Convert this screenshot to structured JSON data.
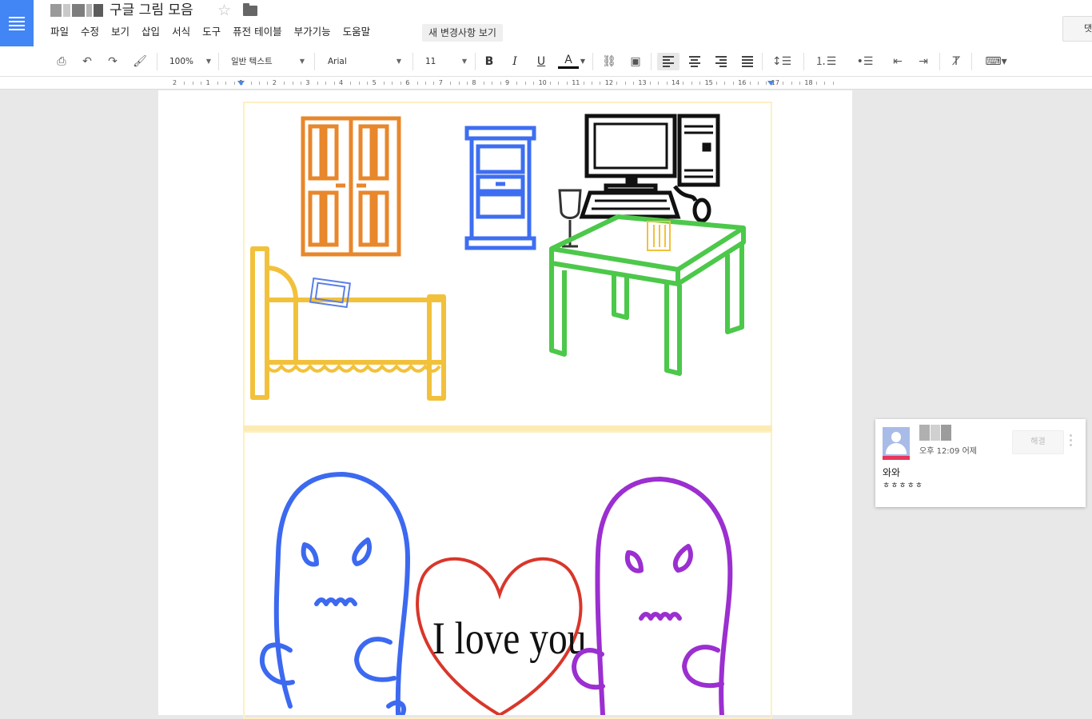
{
  "header": {
    "title": "구글 그림 모음",
    "menu": [
      "파일",
      "수정",
      "보기",
      "삽입",
      "서식",
      "도구",
      "퓨전 테이블",
      "부가기능",
      "도움말"
    ],
    "changes_label": "새 변경사항 보기",
    "comments_label": "댓"
  },
  "toolbar": {
    "zoom": "100%",
    "style": "일반 텍스트",
    "font": "Arial",
    "size": "11",
    "bold": "B",
    "italic": "I",
    "underline": "U",
    "text_color": "A"
  },
  "ruler": {
    "numbers": [
      "2",
      "1",
      "1",
      "2",
      "3",
      "4",
      "5",
      "6",
      "7",
      "8",
      "9",
      "10",
      "11",
      "12",
      "13",
      "14",
      "15",
      "16",
      "17",
      "18"
    ]
  },
  "drawing": {
    "love_text": "I love you"
  },
  "comment": {
    "time": "오후 12:09 어제",
    "resolve_label": "해결",
    "text": "와와",
    "text2": "ㅎㅎㅎㅎㅎ"
  },
  "colors": {
    "brand": "#4285f4",
    "wardrobe": "#e8872b",
    "cabinet": "#3d6ef2",
    "bed": "#f2c13c",
    "table": "#4cc84a",
    "ghost_left": "#3c69f0",
    "ghost_right": "#9b2fd0",
    "heart": "#d9362b"
  }
}
